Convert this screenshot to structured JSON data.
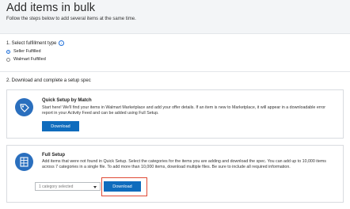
{
  "header": {
    "title": "Add items in bulk",
    "subtitle": "Follow the steps below to add several items at the same time."
  },
  "step1": {
    "label": "1. Select fulfillment type",
    "info_icon": "info-icon",
    "options": [
      {
        "label": "Seller Fulfilled",
        "selected": true
      },
      {
        "label": "Walmart Fulfilled",
        "selected": false
      }
    ]
  },
  "step2": {
    "label": "2. Download and complete a setup spec"
  },
  "quick_setup": {
    "icon": "tag-icon",
    "title": "Quick Setup by Match",
    "description": "Start here! We'll find your items in Walmart Marketplace and add your offer details. If an item is new to Marketplace, it will appear in a downloadable error report in your Activity Feed and can be added using Full Setup.",
    "button_label": "Download"
  },
  "full_setup": {
    "icon": "spreadsheet-icon",
    "title": "Full Setup",
    "description": "Add items that were not found in Quick Setup. Select the categories for the items you are adding and download the spec. You can add up to 10,000 items across 7 categories in a single file. To add more than 10,000 items, download multiple files. Be sure to include all required information.",
    "category_select_value": "1 category selected",
    "button_label": "Download"
  },
  "colors": {
    "primary": "#0f6cbd",
    "highlight": "#e04a35",
    "header_bg": "#f3f5f7"
  }
}
